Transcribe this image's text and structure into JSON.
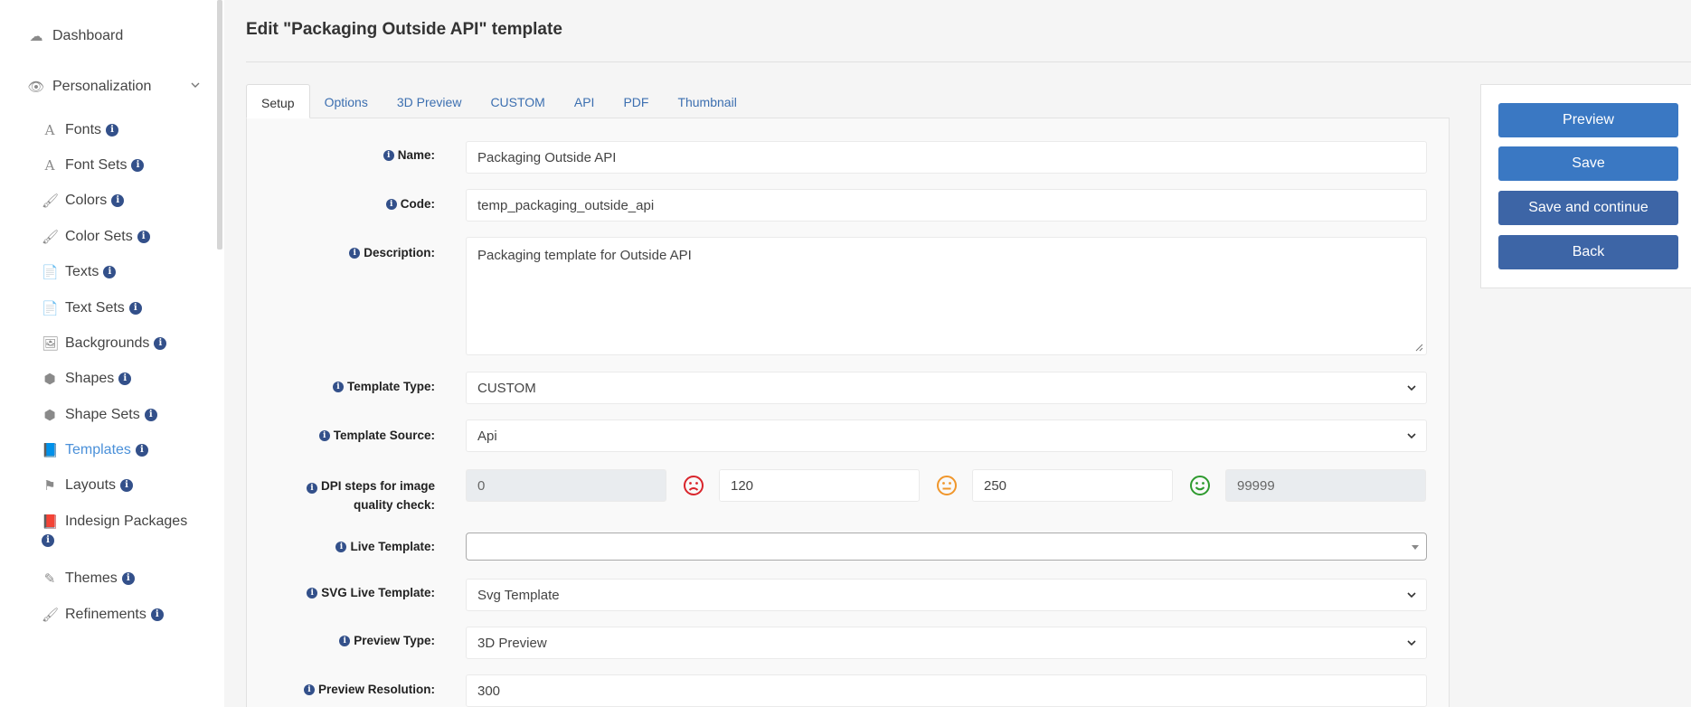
{
  "sidebar": {
    "dashboard": "Dashboard",
    "personalization": "Personalization",
    "items": [
      {
        "label": "Fonts",
        "icon": "font-icon",
        "glyph": "A"
      },
      {
        "label": "Font Sets",
        "icon": "font-icon",
        "glyph": "A"
      },
      {
        "label": "Colors",
        "icon": "paint-brush-icon",
        "glyph": "🖌"
      },
      {
        "label": "Color Sets",
        "icon": "paint-brush-icon",
        "glyph": "🖌"
      },
      {
        "label": "Texts",
        "icon": "file-text-icon",
        "glyph": "📄"
      },
      {
        "label": "Text Sets",
        "icon": "file-text-icon",
        "glyph": "📄"
      },
      {
        "label": "Backgrounds",
        "icon": "image-icon",
        "glyph": "🖼"
      },
      {
        "label": "Shapes",
        "icon": "cube-icon",
        "glyph": "⬢"
      },
      {
        "label": "Shape Sets",
        "icon": "cube-icon",
        "glyph": "⬢"
      },
      {
        "label": "Templates",
        "icon": "book-icon",
        "glyph": "📘"
      },
      {
        "label": "Layouts",
        "icon": "flag-icon",
        "glyph": "⚑"
      },
      {
        "label": "Indesign Packages",
        "icon": "book-icon",
        "glyph": "📕"
      },
      {
        "label": "Themes",
        "icon": "eyedropper-icon",
        "glyph": "✎"
      },
      {
        "label": "Refinements",
        "icon": "paint-brush-icon",
        "glyph": "🖌"
      }
    ],
    "info_glyph": "i"
  },
  "header": {
    "title": "Edit \"Packaging Outside API\" template"
  },
  "tabs": [
    "Setup",
    "Options",
    "3D Preview",
    "CUSTOM",
    "API",
    "PDF",
    "Thumbnail"
  ],
  "form": {
    "name": {
      "label": "Name:",
      "value": "Packaging Outside API"
    },
    "code": {
      "label": "Code:",
      "value": "temp_packaging_outside_api"
    },
    "description": {
      "label": "Description:",
      "value": "Packaging template for Outside API"
    },
    "template_type": {
      "label": "Template Type:",
      "value": "CUSTOM"
    },
    "template_source": {
      "label": "Template Source:",
      "value": "Api"
    },
    "dpi": {
      "label_line1": "DPI steps for image",
      "label_line2": "quality check:",
      "values": [
        "0",
        "120",
        "250",
        "99999"
      ]
    },
    "live_template": {
      "label": "Live Template:",
      "value": ""
    },
    "svg_live_template": {
      "label": "SVG Live Template:",
      "value": "Svg Template"
    },
    "preview_type": {
      "label": "Preview Type:",
      "value": "3D Preview"
    },
    "preview_resolution": {
      "label": "Preview Resolution:",
      "value": "300"
    }
  },
  "actions": {
    "preview": "Preview",
    "save": "Save",
    "save_continue": "Save and continue",
    "back": "Back"
  },
  "colors": {
    "accent": "#3a78c3",
    "active_nav": "#4a90d9",
    "bad": "#d9242b",
    "neutral": "#f0962b",
    "good": "#2e9a2e"
  }
}
